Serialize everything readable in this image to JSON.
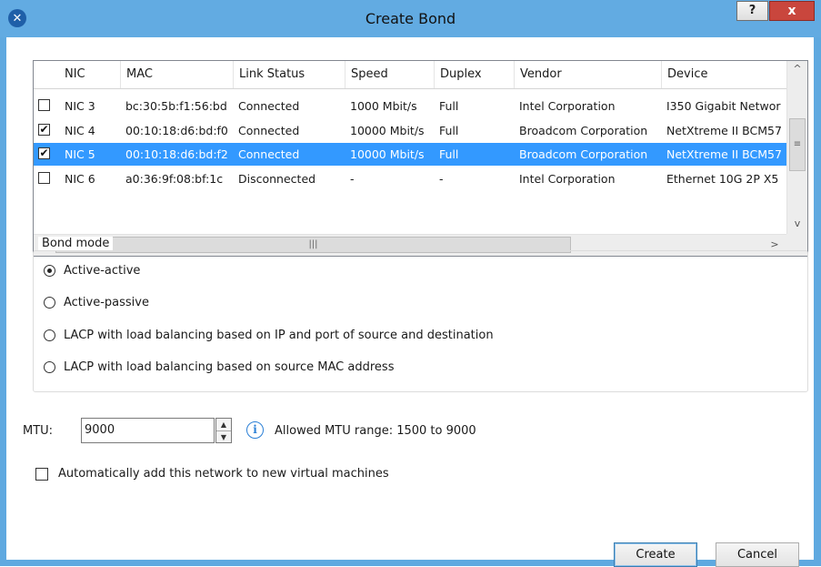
{
  "window": {
    "title": "Create Bond",
    "help_label": "?",
    "close_label": "x",
    "app_icon": "citrix-x-icon"
  },
  "table": {
    "columns": [
      "NIC",
      "MAC",
      "Link Status",
      "Speed",
      "Duplex",
      "Vendor",
      "Device"
    ],
    "rows": [
      {
        "checked": false,
        "nic": "NIC 3",
        "mac": "bc:30:5b:f1:56:bd",
        "link": "Connected",
        "speed": "1000 Mbit/s",
        "duplex": "Full",
        "vendor": "Intel Corporation",
        "device": "I350 Gigabit Networ"
      },
      {
        "checked": true,
        "nic": "NIC 4",
        "mac": "00:10:18:d6:bd:f0",
        "link": "Connected",
        "speed": "10000 Mbit/s",
        "duplex": "Full",
        "vendor": "Broadcom Corporation",
        "device": "NetXtreme II BCM57"
      },
      {
        "checked": true,
        "nic": "NIC 5",
        "mac": "00:10:18:d6:bd:f2",
        "link": "Connected",
        "speed": "10000 Mbit/s",
        "duplex": "Full",
        "vendor": "Broadcom Corporation",
        "device": "NetXtreme II BCM57",
        "selected": true
      },
      {
        "checked": false,
        "nic": "NIC 6",
        "mac": "a0:36:9f:08:bf:1c",
        "link": "Disconnected",
        "speed": "-",
        "duplex": "-",
        "vendor": "Intel Corporation",
        "device": "Ethernet 10G 2P X5"
      }
    ],
    "selection_color": "#3399ff"
  },
  "bond_mode": {
    "legend": "Bond mode",
    "options": [
      {
        "label": "Active-active",
        "selected": true
      },
      {
        "label": "Active-passive",
        "selected": false
      },
      {
        "label": "LACP with load balancing based on IP and port of source and destination",
        "selected": false
      },
      {
        "label": "LACP with load balancing based on source MAC address",
        "selected": false
      }
    ]
  },
  "mtu": {
    "label": "MTU:",
    "value": "9000",
    "info_text": "Allowed MTU range: 1500 to 9000"
  },
  "auto_add": {
    "label": "Automatically add this network to new virtual machines",
    "checked": false
  },
  "buttons": {
    "create": "Create",
    "cancel": "Cancel"
  }
}
